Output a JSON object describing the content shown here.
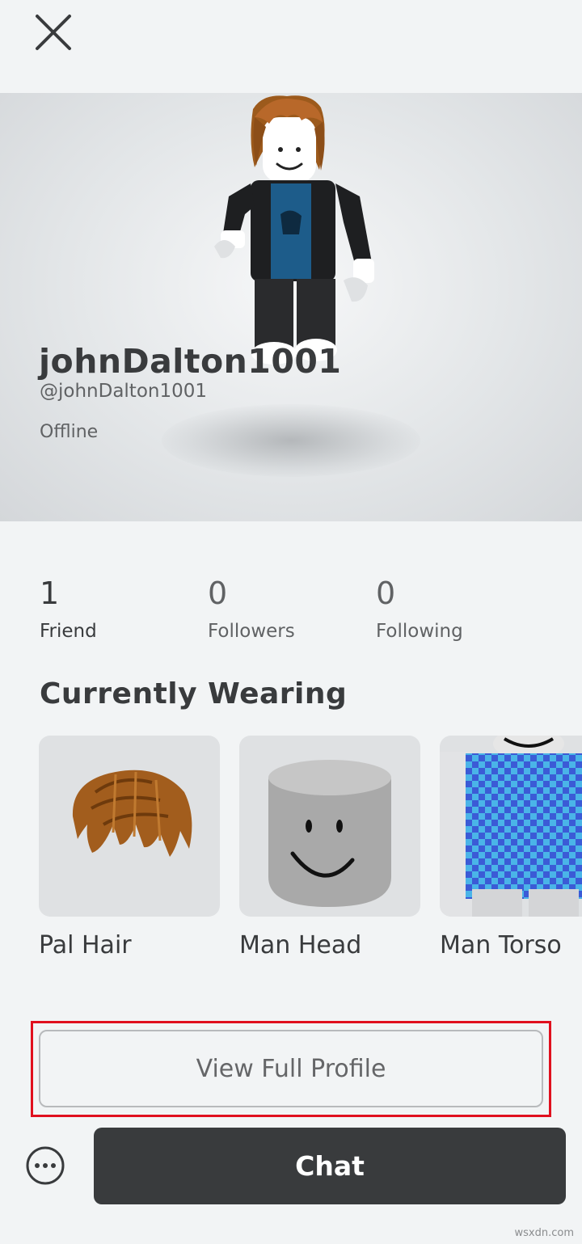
{
  "profile": {
    "display_name": "johnDalton1001",
    "username": "@johnDalton1001",
    "status": "Offline"
  },
  "stats": [
    {
      "count": "1",
      "label": "Friend"
    },
    {
      "count": "0",
      "label": "Followers"
    },
    {
      "count": "0",
      "label": "Following"
    }
  ],
  "wearing": {
    "title": "Currently Wearing",
    "items": [
      {
        "name": "Pal Hair"
      },
      {
        "name": "Man Head"
      },
      {
        "name": "Man Torso"
      }
    ]
  },
  "actions": {
    "view_full_profile": "View Full Profile",
    "chat": "Chat"
  },
  "icons": {
    "close": "close-icon",
    "more": "more-options-icon"
  },
  "colors": {
    "background": "#f2f4f5",
    "chat_button": "#393b3d",
    "highlight": "#e0101e"
  },
  "watermark": "wsxdn.com"
}
